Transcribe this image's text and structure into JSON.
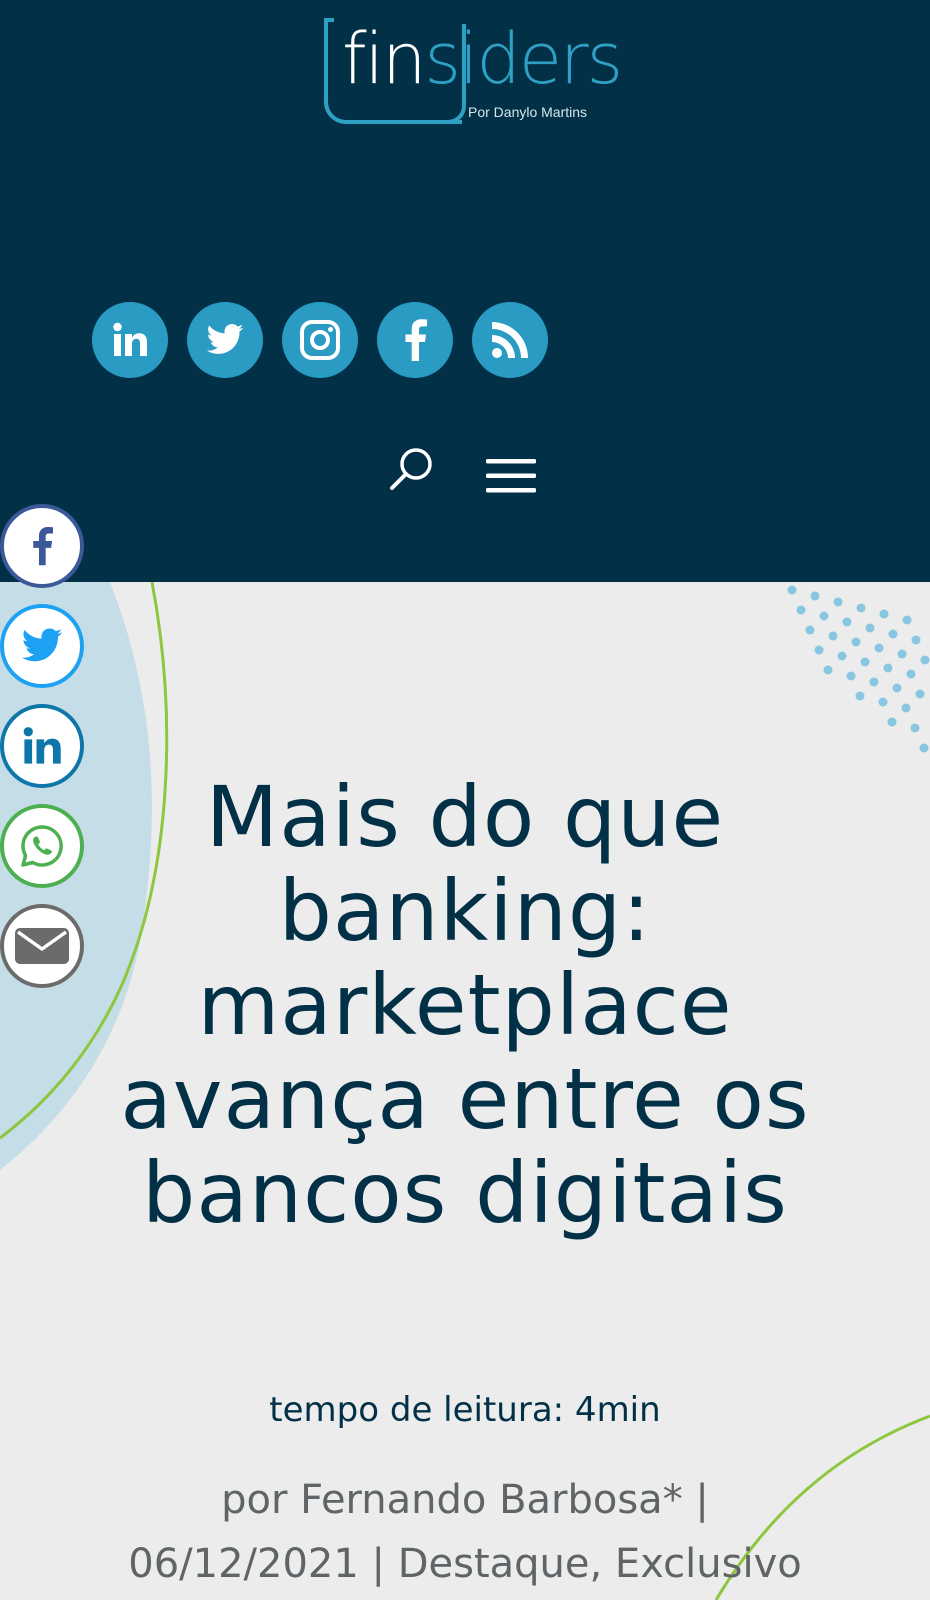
{
  "header": {
    "logo": {
      "part1": "fin",
      "part2": "siders",
      "subtitle": "Por Danylo Martins"
    },
    "social": [
      {
        "name": "linkedin-icon"
      },
      {
        "name": "twitter-icon"
      },
      {
        "name": "instagram-icon"
      },
      {
        "name": "facebook-icon"
      },
      {
        "name": "rss-icon"
      }
    ],
    "tools": {
      "search": "search-icon",
      "menu": "hamburger-menu-icon"
    }
  },
  "share": [
    {
      "name": "facebook-share",
      "color": "#3b5998"
    },
    {
      "name": "twitter-share",
      "color": "#1da1f2"
    },
    {
      "name": "linkedin-share",
      "color": "#0e76a8"
    },
    {
      "name": "whatsapp-share",
      "color": "#4caf50"
    },
    {
      "name": "email-share",
      "color": "#6b6b6b"
    }
  ],
  "article": {
    "title": "Mais do que banking: marketplace avança entre os bancos digitais",
    "reading_time": "tempo de leitura: 4min",
    "byline": {
      "line1": "por Fernando Barbosa* |",
      "line2": "06/12/2021 | Destaque, Exclusivo"
    }
  },
  "colors": {
    "header_bg": "#023047",
    "accent": "#2ea0c4",
    "title": "#023047",
    "page_bg": "#ececec"
  }
}
